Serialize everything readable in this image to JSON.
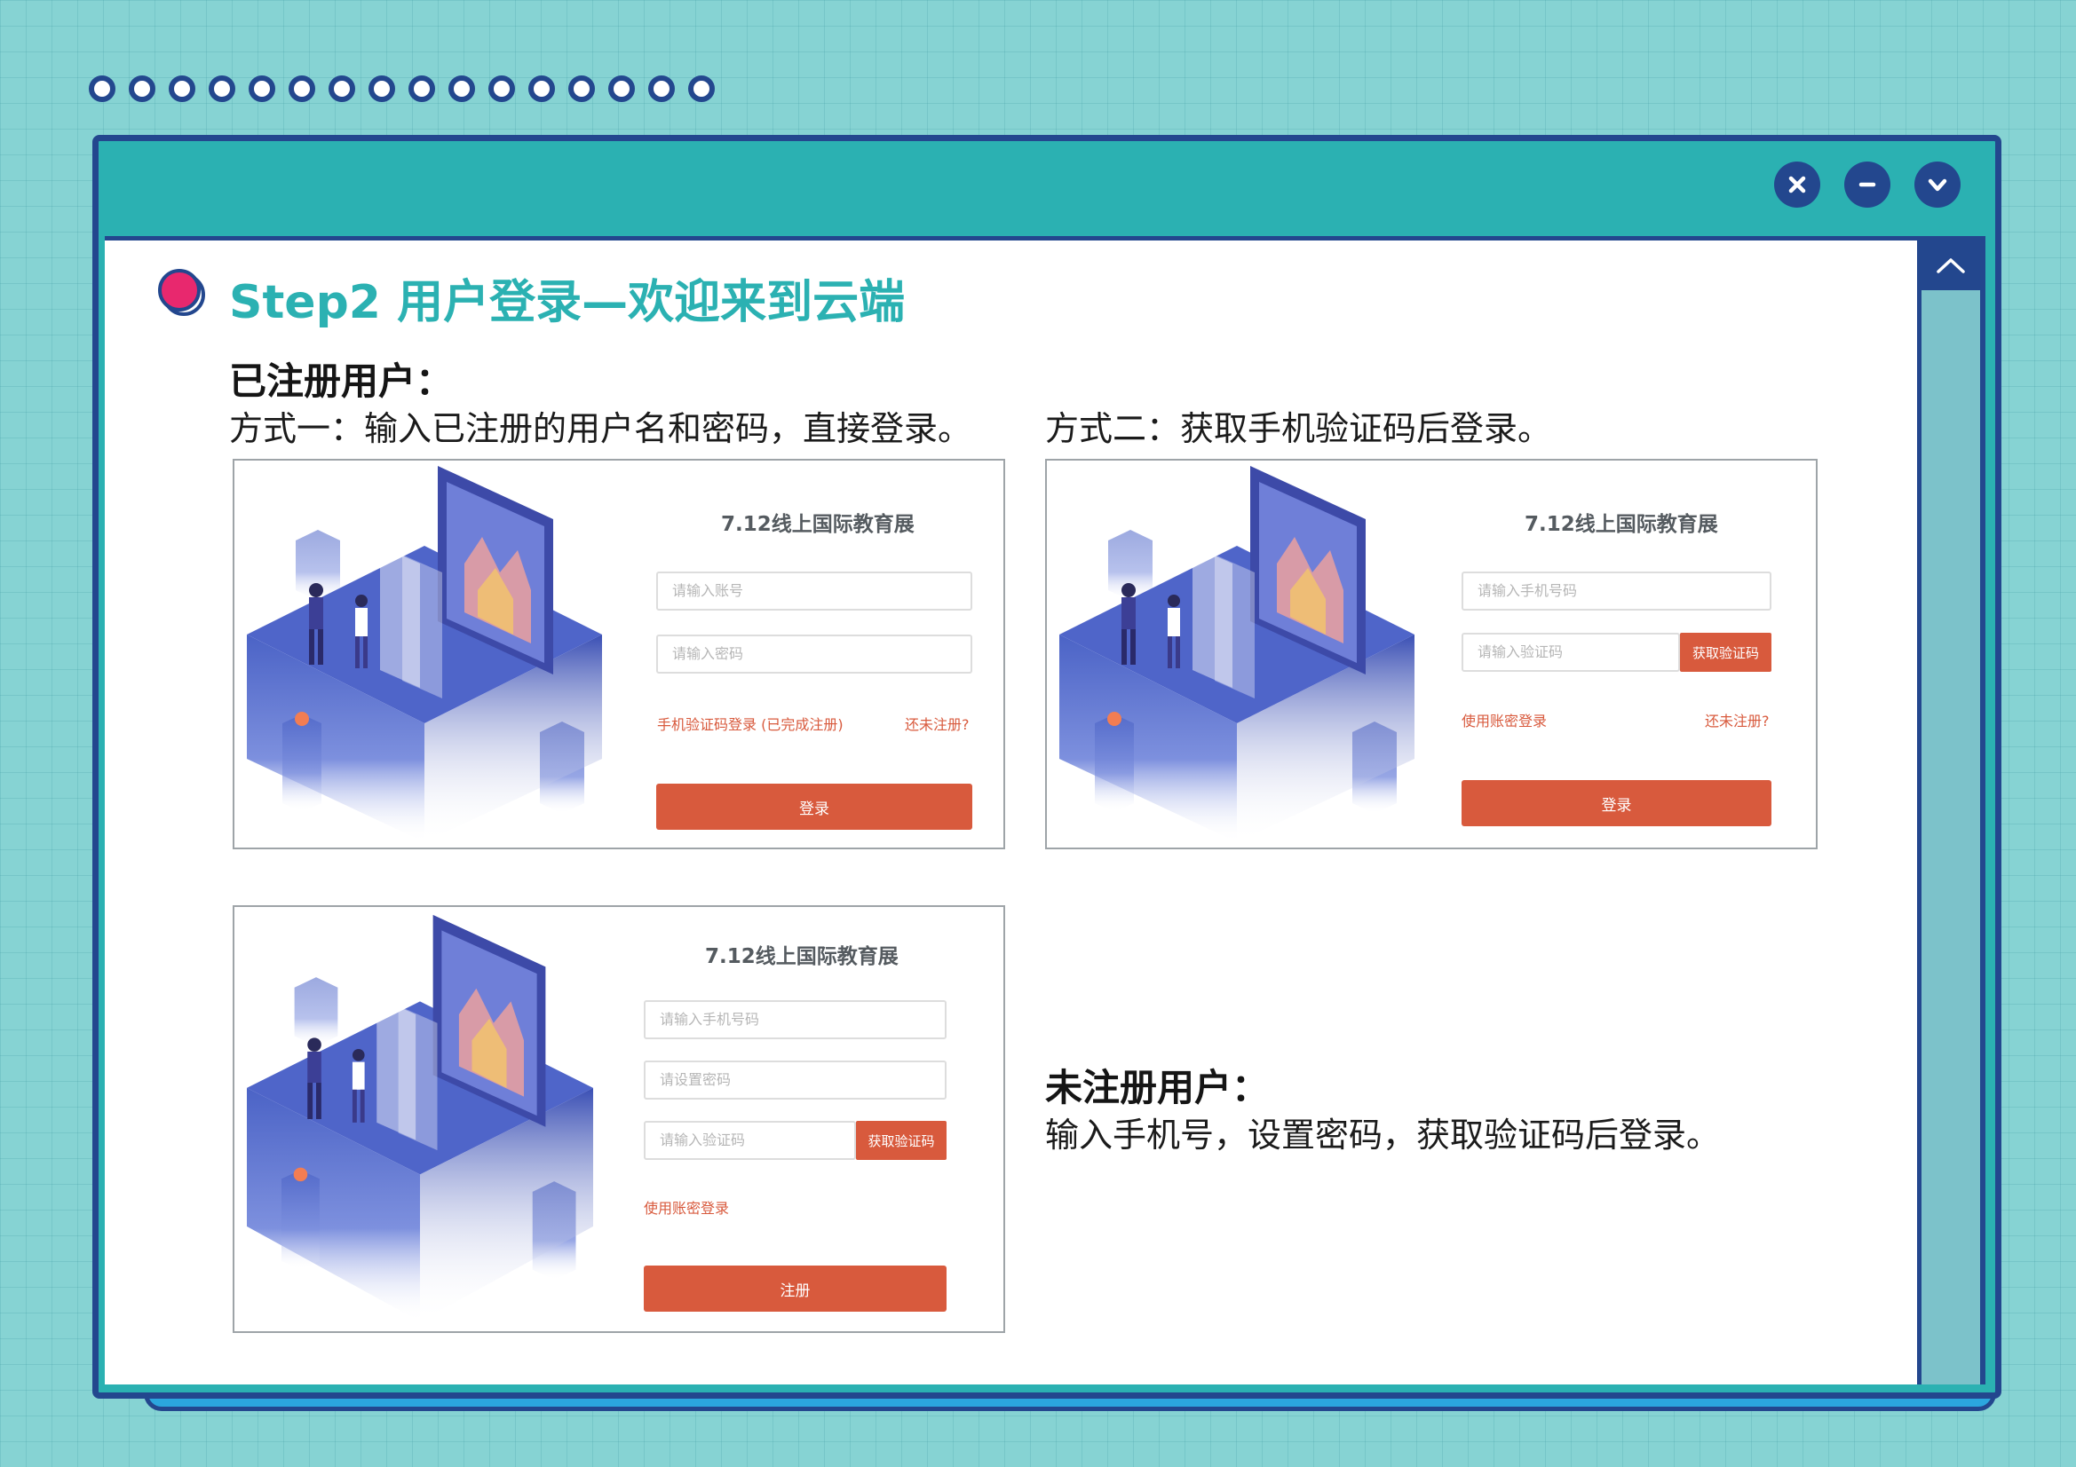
{
  "window": {
    "controls": [
      "close-icon",
      "minimize-icon",
      "chevron-down-icon"
    ],
    "scroll_up_icon": "chevron-up-icon"
  },
  "heading": "Step2 用户登录—欢迎来到云端",
  "registered": {
    "title": "已注册用户：",
    "method1_text": "方式一：输入已注册的用户名和密码，直接登录。",
    "method2_text": "方式二：获取手机验证码后登录。"
  },
  "unregistered": {
    "title": "未注册用户：",
    "text": "输入手机号，设置密码，获取验证码后登录。"
  },
  "shot1": {
    "title": "7.12线上国际教育展",
    "account_placeholder": "请输入账号",
    "password_placeholder": "请输入密码",
    "sms_login_link": "手机验证码登录 (已完成注册)",
    "register_link": "还未注册?",
    "login_button": "登录"
  },
  "shot2": {
    "title": "7.12线上国际教育展",
    "phone_placeholder": "请输入手机号码",
    "code_placeholder": "请输入验证码",
    "get_code_button": "获取验证码",
    "password_login_link": "使用账密登录",
    "register_link": "还未注册?",
    "login_button": "登录"
  },
  "shot3": {
    "title": "7.12线上国际教育展",
    "phone_placeholder": "请输入手机号码",
    "set_password_placeholder": "请设置密码",
    "code_placeholder": "请输入验证码",
    "get_code_button": "获取验证码",
    "password_login_link": "使用账密登录",
    "register_button": "注册"
  },
  "colors": {
    "background": "#86d3d3",
    "navy": "#23478e",
    "teal": "#2bb1b2",
    "accent_red": "#d85a3d",
    "bullet_pink": "#e8286e"
  }
}
